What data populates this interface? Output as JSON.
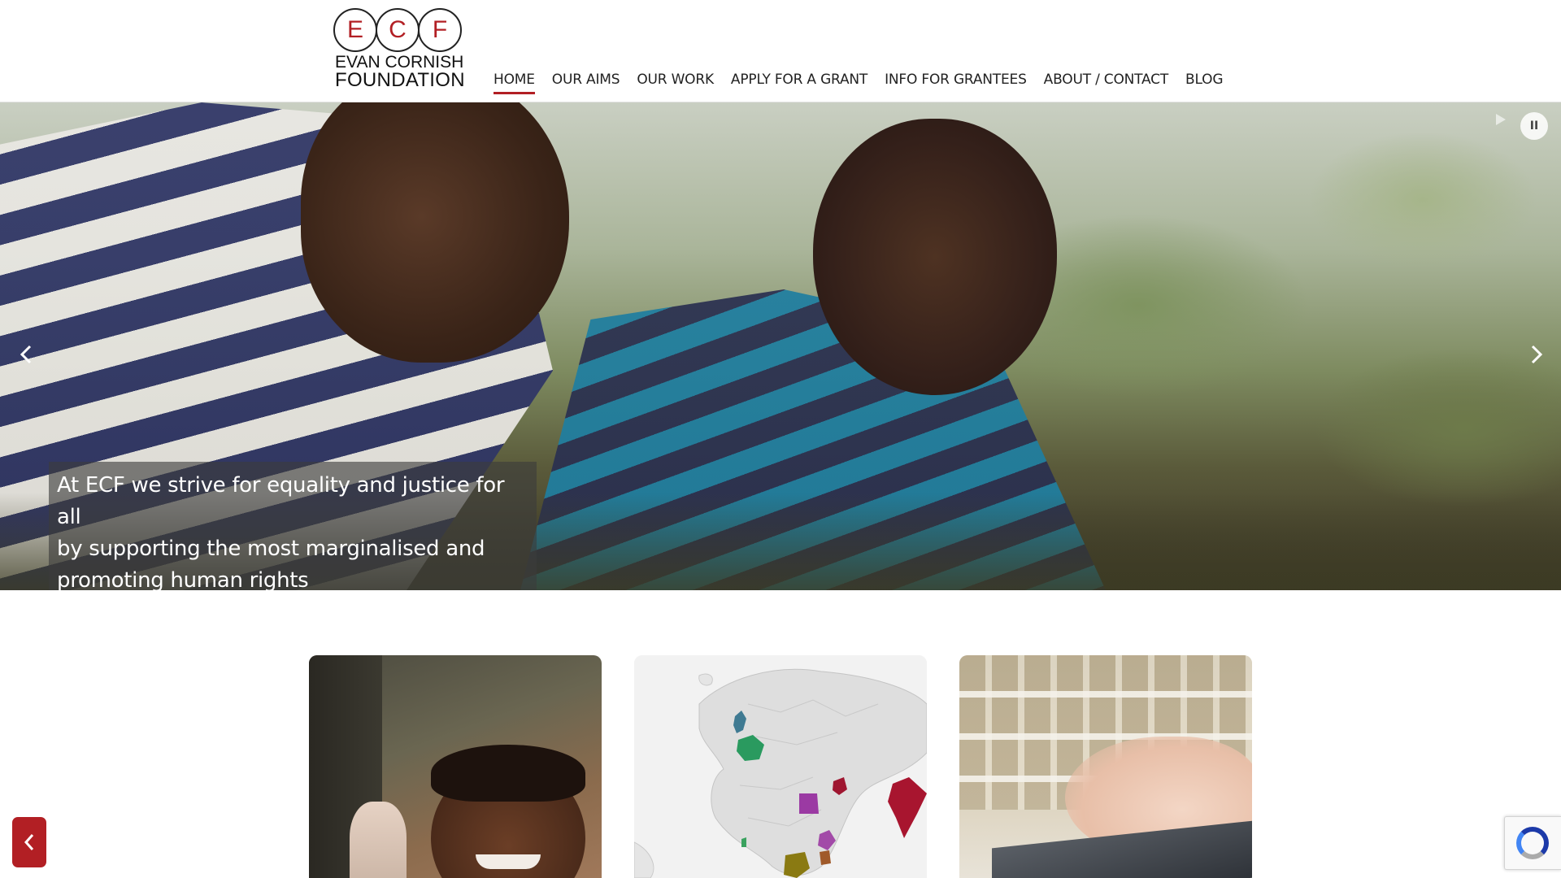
{
  "logo": {
    "letters": [
      "E",
      "C",
      "F"
    ],
    "line1": "EVAN CORNISH",
    "line2": "FOUNDATION"
  },
  "nav": {
    "items": [
      {
        "label": "HOME",
        "active": true
      },
      {
        "label": "OUR AIMS"
      },
      {
        "label": "OUR WORK"
      },
      {
        "label": "APPLY FOR A GRANT"
      },
      {
        "label": "INFO FOR GRANTEES"
      },
      {
        "label": "ABOUT / CONTACT"
      },
      {
        "label": "BLOG"
      }
    ]
  },
  "hero": {
    "caption_lines": [
      "At ECF we strive for equality and justice for all",
      "by supporting the most marginalised and",
      "promoting human rights"
    ],
    "prev_icon": "chevron-left-icon",
    "next_icon": "chevron-right-icon",
    "play_icon": "play-icon",
    "pause_icon": "pause-icon",
    "pause_glyph": "II"
  },
  "cards": [
    {
      "image": "smiling-girl-photo"
    },
    {
      "image": "world-map-grants"
    },
    {
      "image": "typing-laptop-photo"
    }
  ],
  "map_colors": {
    "uk": "#3f7a92",
    "france": "#2a9a5f",
    "egypt": "#9b3aa3",
    "iraq": "#9f1630",
    "india": "#a8152f",
    "kenya": "#a24aa8",
    "tanzania": "#a05a2a",
    "drc": "#8a7a12",
    "ghana": "#3aa25f"
  },
  "floating": {
    "back_glyph": "‹",
    "back_icon": "chevron-left-icon"
  },
  "colors": {
    "brand": "#b21f24"
  }
}
